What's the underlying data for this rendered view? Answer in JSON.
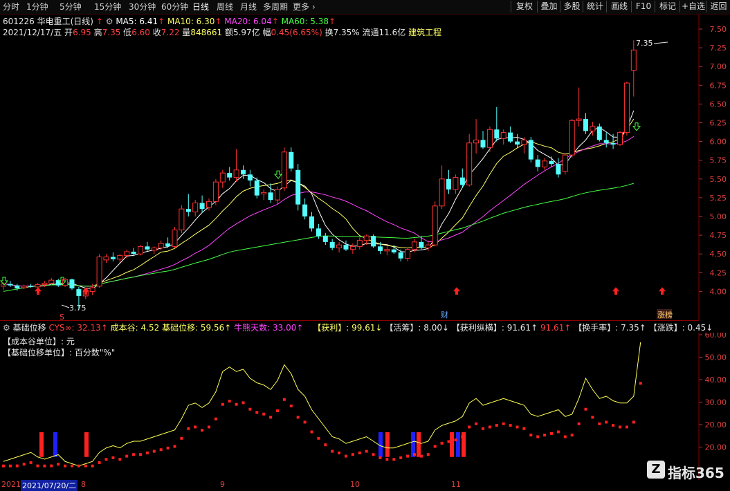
{
  "toolbar": {
    "left_tabs": [
      "分时",
      "1分钟",
      "5分钟",
      "15分钟",
      "30分钟",
      "60分钟",
      "日线",
      "周线",
      "月线",
      "多周期",
      "更多"
    ],
    "active_tab": "日线",
    "right_buttons": [
      "复权",
      "叠加",
      "多股",
      "统计",
      "画线",
      "F10",
      "标记",
      "+自选",
      "返回"
    ]
  },
  "stock": {
    "title": "601226 华电重工(日线)",
    "ma": [
      {
        "label": "MA5: 6.41",
        "color": "#ffffff"
      },
      {
        "label": "MA10: 6.30",
        "color": "#ffff66"
      },
      {
        "label": "MA20: 6.04",
        "color": "#ff44ff"
      },
      {
        "label": "MA60: 5.38",
        "color": "#44ff44"
      }
    ],
    "date": "2021/12/17/五",
    "open_label": "开",
    "open": "6.95",
    "high_label": "高",
    "high": "7.35",
    "low_label": "低",
    "low": "6.60",
    "close_label": "收",
    "close": "7.22",
    "vol_label": "量",
    "vol": "848661",
    "amt_label": "额",
    "amt": "5.97亿",
    "chg_label": "幅",
    "chg": "0.45(6.65%)",
    "turnover": "换7.35%",
    "float": "流通11.6亿",
    "sector": "建筑工程"
  },
  "price_axis": [
    "7.50",
    "7.25",
    "7.00",
    "6.75",
    "6.50",
    "6.25",
    "6.00",
    "5.75",
    "5.50",
    "5.25",
    "5.00",
    "4.75",
    "4.50",
    "4.25",
    "4.00"
  ],
  "annotations": {
    "high_label": "7.35",
    "low_label": "3.75",
    "cai": "财",
    "zhangting": "涨榜",
    "s_mark": "S"
  },
  "indicator": {
    "name": "基础位移",
    "cys": "CYS∞: 32.13↑",
    "cost_valley": "成本谷: 4.52",
    "base_shift": "基础位移: 59.56↑",
    "bull_days": "牛熊天数: 33.00↑",
    "profit": "【获利】: 99.61↓",
    "active": "【活筹】: 8.00↓",
    "profit_vert": "【获利纵横】: 91.61↑",
    "profit_vert2": "91.61↑",
    "turnover": "【换手率】: 7.35↑",
    "zhangdie": "【涨跌】: 0.45↓",
    "unit1": "【成本谷单位】: 元",
    "unit2": "【基础位移单位】: 百分数\"%\"",
    "axis": [
      "60.00",
      "50.00",
      "40.00",
      "30.00",
      "20.00",
      "20.00"
    ]
  },
  "bottom": {
    "year": "2021",
    "date": "2021/07/20/二",
    "months": [
      "8",
      "9",
      "10",
      "11"
    ]
  },
  "logo": {
    "text": "指标365"
  }
}
